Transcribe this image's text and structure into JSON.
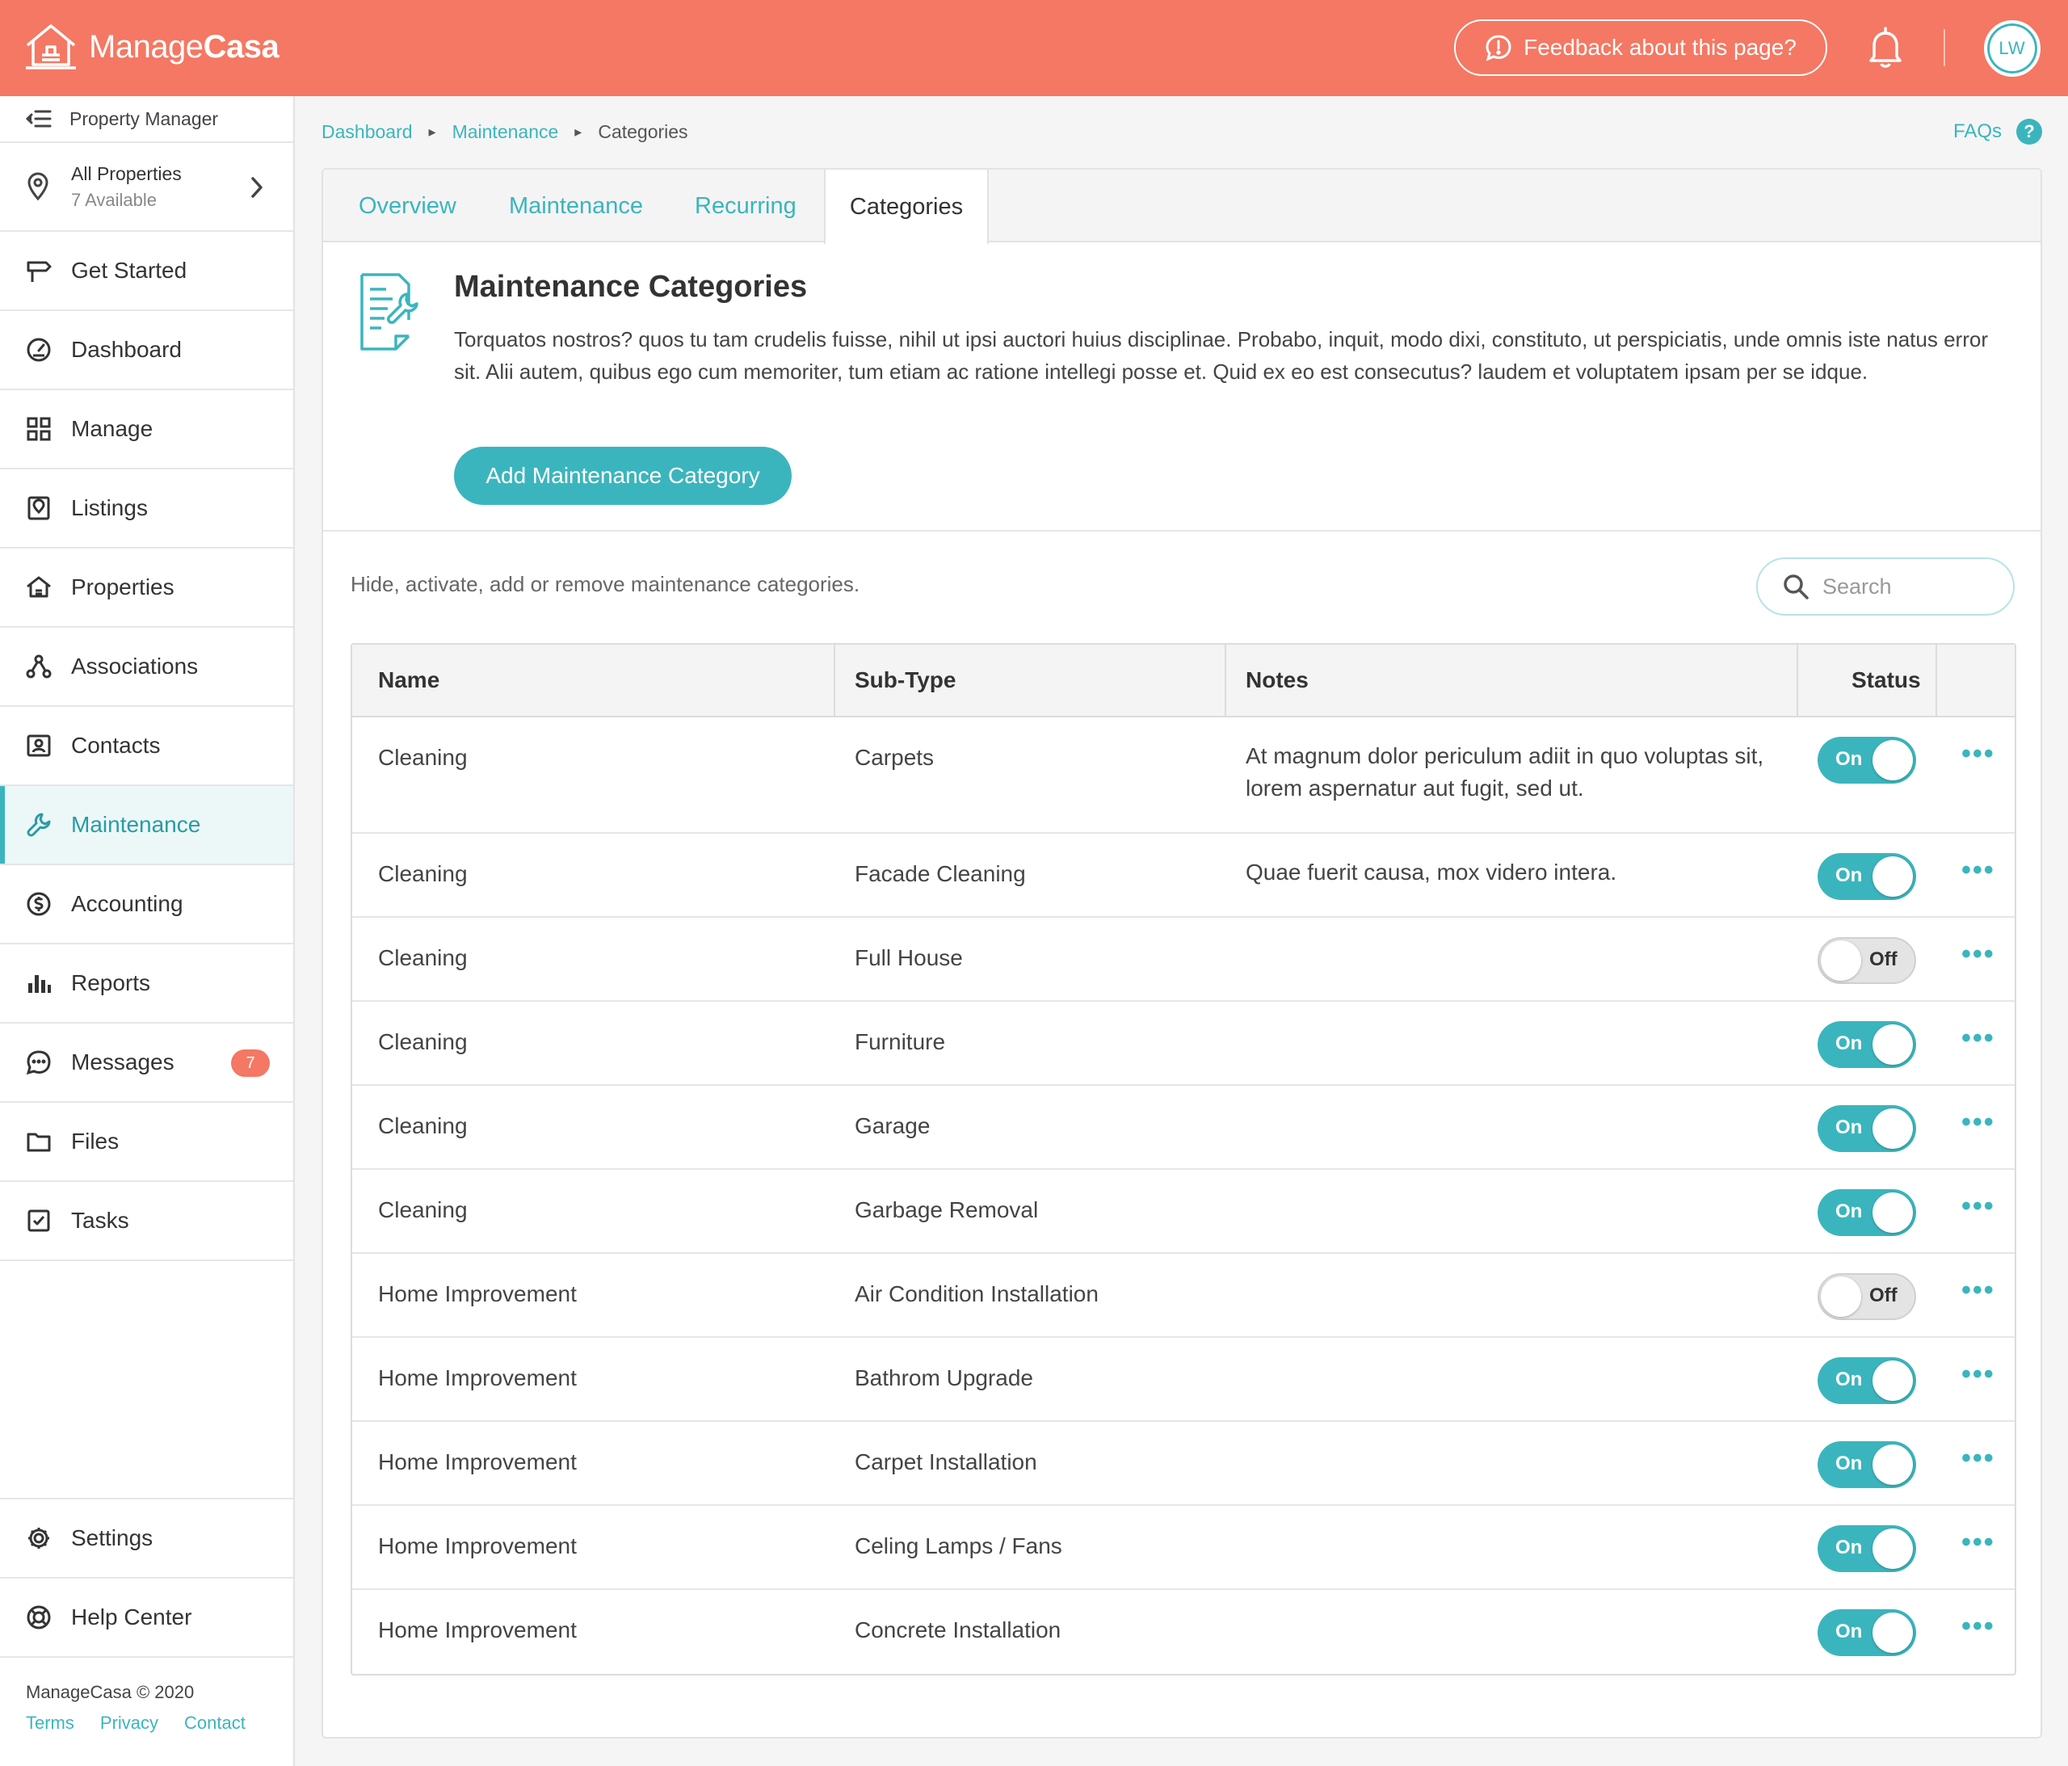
{
  "app": {
    "logo_part1": "Manage",
    "logo_part2": "Casa",
    "feedback_label": "Feedback about this page?",
    "avatar_initials": "LW",
    "brand_color": "#f47863",
    "accent_color": "#3bb5bd"
  },
  "sidebar": {
    "role_label": "Property Manager",
    "properties_title": "All Properties",
    "properties_sub": "7 Available",
    "items": [
      {
        "label": "Get Started",
        "icon": "signpost-icon"
      },
      {
        "label": "Dashboard",
        "icon": "gauge-icon"
      },
      {
        "label": "Manage",
        "icon": "grid-icon"
      },
      {
        "label": "Listings",
        "icon": "listing-icon"
      },
      {
        "label": "Properties",
        "icon": "house-icon"
      },
      {
        "label": "Associations",
        "icon": "network-icon"
      },
      {
        "label": "Contacts",
        "icon": "contact-card-icon"
      },
      {
        "label": "Maintenance",
        "icon": "wrench-icon"
      },
      {
        "label": "Accounting",
        "icon": "dollar-icon"
      },
      {
        "label": "Reports",
        "icon": "bar-chart-icon"
      },
      {
        "label": "Messages",
        "icon": "chat-icon"
      },
      {
        "label": "Files",
        "icon": "folder-icon"
      },
      {
        "label": "Tasks",
        "icon": "checkbox-icon"
      }
    ],
    "messages_badge": "7",
    "bottom_items": [
      {
        "label": "Settings",
        "icon": "gear-icon"
      },
      {
        "label": "Help Center",
        "icon": "lifebuoy-icon"
      }
    ],
    "footer": {
      "copyright": "ManageCasa © 2020",
      "links": [
        "Terms",
        "Privacy",
        "Contact"
      ]
    }
  },
  "breadcrumb": [
    "Dashboard",
    "Maintenance",
    "Categories"
  ],
  "faqs_label": "FAQs",
  "tabs": [
    "Overview",
    "Maintenance",
    "Recurring",
    "Categories"
  ],
  "active_tab": "Categories",
  "intro": {
    "title": "Maintenance Categories",
    "text": "Torquatos nostros? quos tu tam crudelis fuisse, nihil ut ipsi auctori huius disciplinae. Probabo, inquit, modo dixi, constituto, ut perspiciatis, unde omnis iste natus error sit. Alii autem, quibus ego cum memoriter, tum etiam ac ratione intellegi posse et. Quid ex eo est consecutus? laudem et voluptatem ipsam per se idque.",
    "add_button": "Add Maintenance Category"
  },
  "hint": "Hide, activate, add or remove maintenance categories.",
  "search_placeholder": "Search",
  "table": {
    "headers": [
      "Name",
      "Sub-Type",
      "Notes",
      "Status"
    ],
    "rows": [
      {
        "name": "Cleaning",
        "subtype": "Carpets",
        "notes": "At magnum dolor periculum adiit in quo voluptas sit, lorem aspernatur aut fugit, sed ut.",
        "status": "On"
      },
      {
        "name": "Cleaning",
        "subtype": "Facade Cleaning",
        "notes": "Quae fuerit causa, mox videro intera.",
        "status": "On"
      },
      {
        "name": "Cleaning",
        "subtype": "Full House",
        "notes": "",
        "status": "Off"
      },
      {
        "name": "Cleaning",
        "subtype": "Furniture",
        "notes": "",
        "status": "On"
      },
      {
        "name": "Cleaning",
        "subtype": "Garage",
        "notes": "",
        "status": "On"
      },
      {
        "name": "Cleaning",
        "subtype": "Garbage Removal",
        "notes": "",
        "status": "On"
      },
      {
        "name": "Home Improvement",
        "subtype": "Air Condition Installation",
        "notes": "",
        "status": "Off"
      },
      {
        "name": "Home Improvement",
        "subtype": "Bathrom Upgrade",
        "notes": "",
        "status": "On"
      },
      {
        "name": "Home Improvement",
        "subtype": "Carpet Installation",
        "notes": "",
        "status": "On"
      },
      {
        "name": "Home Improvement",
        "subtype": "Celing Lamps / Fans",
        "notes": "",
        "status": "On"
      },
      {
        "name": "Home Improvement",
        "subtype": "Concrete Installation",
        "notes": "",
        "status": "On"
      }
    ]
  }
}
